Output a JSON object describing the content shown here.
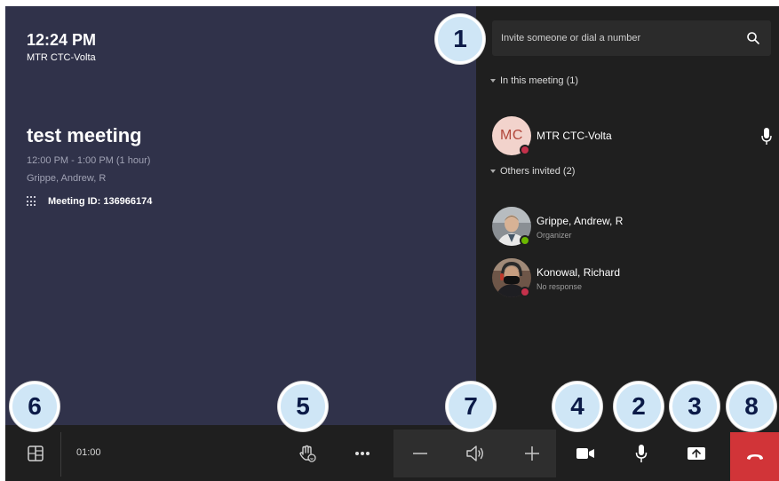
{
  "header": {
    "time": "12:24 PM",
    "room_name": "MTR CTC-Volta"
  },
  "meeting": {
    "title": "test meeting",
    "time_range": "12:00 PM - 1:00 PM (1 hour)",
    "organizer": "Grippe, Andrew, R",
    "meeting_id": "Meeting ID: 136966174"
  },
  "roster": {
    "search_placeholder": "Invite someone or dial a number",
    "in_meeting_label": "In this meeting (1)",
    "others_label": "Others invited (2)",
    "participants": [
      {
        "initials": "MC",
        "name": "MTR CTC-Volta",
        "status_color": "#c4314b"
      }
    ],
    "invited": [
      {
        "name": "Grippe, Andrew, R",
        "subtitle": "Organizer",
        "status_color": "#6bb700"
      },
      {
        "name": "Konowal, Richard",
        "subtitle": "No response",
        "status_color": "#c4314b"
      }
    ]
  },
  "toolbar": {
    "timer": "01:00",
    "hangup_color": "#d13438",
    "icons": [
      "layout-icon",
      "raise-hand-icon",
      "more-options-icon",
      "volume-down-icon",
      "speaker-icon",
      "volume-up-icon",
      "camera-icon",
      "microphone-icon",
      "share-screen-icon",
      "hang-up-icon"
    ]
  },
  "callouts": {
    "c1": "1",
    "c2": "2",
    "c3": "3",
    "c4": "4",
    "c5": "5",
    "c6": "6",
    "c7": "7",
    "c8": "8",
    "fill": "#cfe6f6",
    "text_color": "#0b1a47"
  }
}
